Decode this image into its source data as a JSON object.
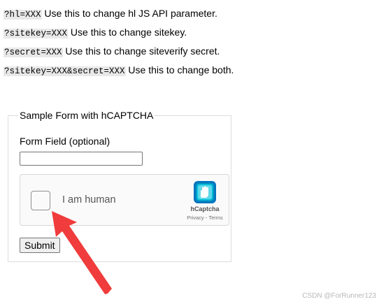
{
  "params": [
    {
      "code": "?hl=XXX",
      "text": "Use this to change hl JS API parameter."
    },
    {
      "code": "?sitekey=XXX",
      "text": "Use this to change sitekey."
    },
    {
      "code": "?secret=XXX",
      "text": "Use this to change siteverify secret."
    },
    {
      "code": "?sitekey=XXX&secret=XXX",
      "text": "Use this to change both."
    }
  ],
  "form": {
    "legend": "Sample Form with hCAPTCHA",
    "field_label": "Form Field (optional)",
    "field_value": "",
    "submit_label": "Submit"
  },
  "hcaptcha": {
    "checkbox_label": "I am human",
    "brand": "hCaptcha",
    "privacy": "Privacy",
    "separator": "-",
    "terms": "Terms"
  },
  "annotation": {
    "arrow_color": "#f03c3c"
  },
  "watermark": "CSDN @ForRunner123"
}
